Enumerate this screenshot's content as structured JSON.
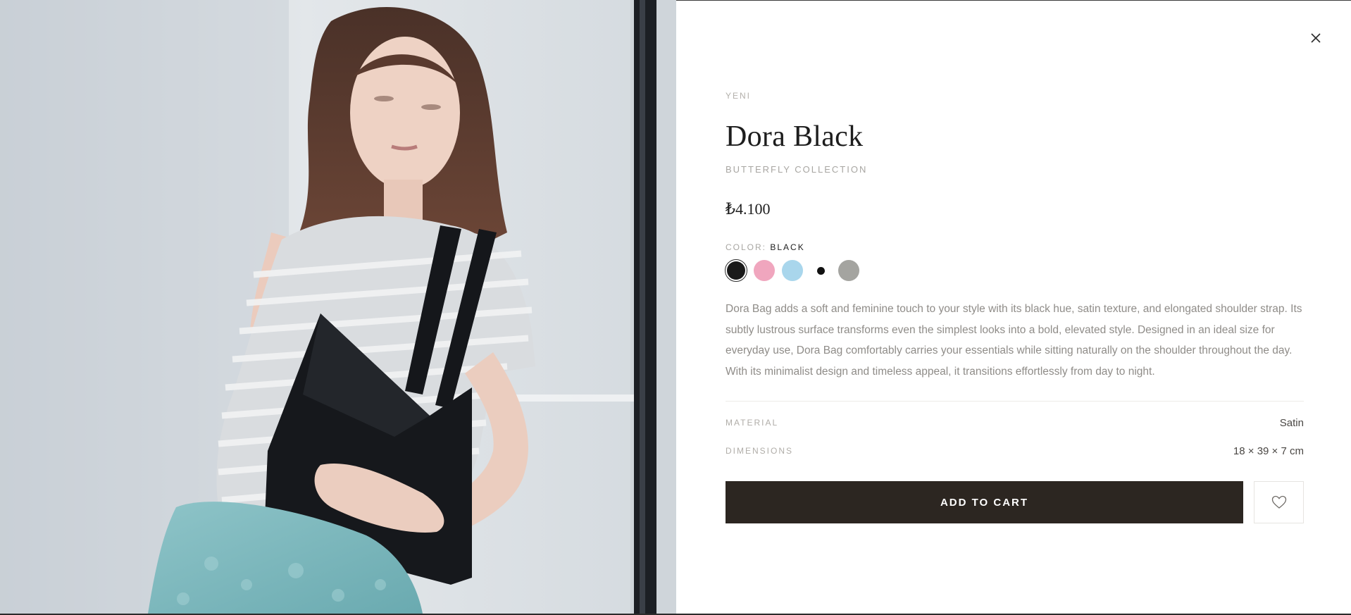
{
  "product": {
    "badge": "YENI",
    "title": "Dora Black",
    "collection": "BUTTERFLY COLLECTION",
    "price": "₺4.100",
    "color_label": "COLOR:",
    "color_value": "BLACK",
    "swatches": [
      {
        "name": "black",
        "hex": "#1a1a1a",
        "selected": true
      },
      {
        "name": "pink",
        "hex": "#f0a6be",
        "selected": false
      },
      {
        "name": "light-blue",
        "hex": "#a9d6ec",
        "selected": false
      },
      {
        "name": "white-black-dot",
        "hex": "#111111",
        "selected": false
      },
      {
        "name": "grey",
        "hex": "#a4a4a0",
        "selected": false
      }
    ],
    "description": "Dora Bag adds a soft and feminine touch to your style with its black hue, satin texture, and elongated shoulder strap. Its subtly lustrous surface transforms even the simplest looks into a bold, elevated style. Designed in an ideal size for everyday use, Dora Bag comfortably carries your essentials while sitting naturally on the shoulder throughout the day. With its minimalist design and timeless appeal, it transitions effortlessly from day to night.",
    "specs": [
      {
        "label": "MATERIAL",
        "value": "Satin"
      },
      {
        "label": "DIMENSIONS",
        "value": "18 × 39 × 7 cm"
      }
    ],
    "add_to_cart_label": "ADD TO CART"
  },
  "icons": {
    "close": "close-icon",
    "wishlist": "heart-icon"
  },
  "colors": {
    "button_bg": "#2c2621",
    "text_muted": "#8f8c88"
  }
}
